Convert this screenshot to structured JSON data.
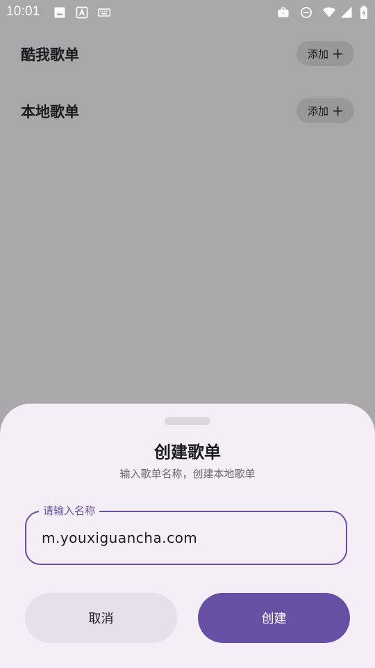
{
  "status_bar": {
    "time": "10:01",
    "icons": [
      "image-icon",
      "text-a-icon",
      "keyboard-icon",
      "briefcase-icon",
      "do-not-disturb-icon",
      "wifi-icon",
      "signal-icon",
      "battery-charging-icon"
    ]
  },
  "sections": [
    {
      "title": "酷我歌单",
      "add_label": "添加"
    },
    {
      "title": "本地歌单",
      "add_label": "添加"
    }
  ],
  "sheet": {
    "title": "创建歌单",
    "subtitle": "输入歌单名称，创建本地歌单",
    "field": {
      "label": "请输入名称",
      "value": "m.youxiguancha.com"
    },
    "cancel_label": "取消",
    "create_label": "创建"
  },
  "colors": {
    "scrim_background": "#aaa7ab",
    "sheet_background": "#f4eff6",
    "accent": "#6750a4",
    "cancel_button": "#e5e0eb"
  }
}
